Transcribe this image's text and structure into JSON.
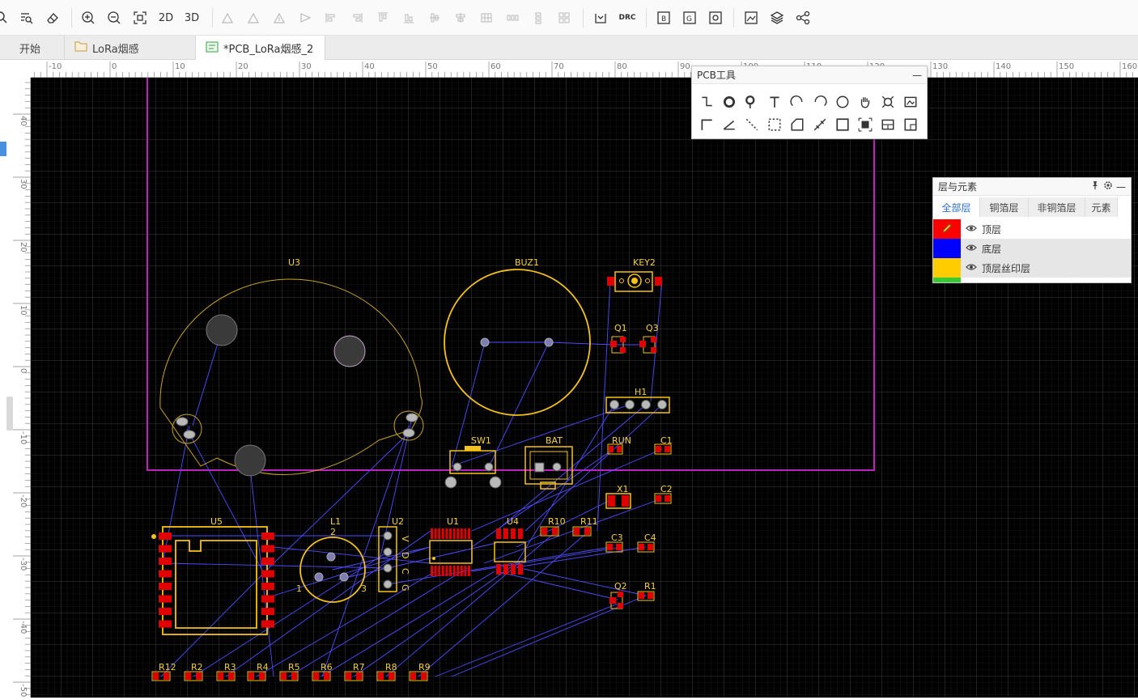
{
  "toolbar": {
    "view2d": "2D",
    "view3d": "3D",
    "drc": "DRC"
  },
  "tabs": [
    {
      "label": "开始"
    },
    {
      "label": "LoRa烟感"
    },
    {
      "label": "*PCB_LoRa烟感_2"
    }
  ],
  "ruler": {
    "top_ticks": [
      "-10",
      "0",
      "10",
      "20",
      "30",
      "40",
      "50",
      "60",
      "70",
      "80",
      "90",
      "100",
      "110",
      "120",
      "130",
      "140",
      "150",
      "160"
    ],
    "left_ticks": [
      "40",
      "30",
      "20",
      "10",
      "0",
      "-10",
      "-20",
      "-30",
      "-40",
      "-50"
    ]
  },
  "pcb_tools": {
    "title": "PCB工具",
    "minimize": "—"
  },
  "layers_panel": {
    "title": "层与元素",
    "tabs": [
      "全部层",
      "铜箔层",
      "非铜箔层",
      "元素"
    ],
    "layers": [
      {
        "name": "顶层",
        "color": "#ff0000"
      },
      {
        "name": "底层",
        "color": "#0000ff"
      },
      {
        "name": "顶层丝印层",
        "color": "#ffcc00"
      }
    ],
    "minimize": "—"
  },
  "components": {
    "U3": "U3",
    "BUZ1": "BUZ1",
    "KEY2": "KEY2",
    "Q1": "Q1",
    "Q3": "Q3",
    "H1": "H1",
    "SW1": "SW1",
    "BAT": "BAT",
    "RUN": "RUN",
    "C1": "C1",
    "X1": "X1",
    "C2": "C2",
    "U5": "U5",
    "L1": "L1",
    "U2": "U2",
    "U1": "U1",
    "U4": "U4",
    "R10": "R10",
    "R11": "R11",
    "C3": "C3",
    "C4": "C4",
    "Q2": "Q2",
    "R1": "R1",
    "R12": "R12",
    "R2": "R2",
    "R3": "R3",
    "R4": "R4",
    "R5": "R5",
    "R6": "R6",
    "R7": "R7",
    "R8": "R8",
    "R9": "R9",
    "L1_pin2": "2",
    "L1_pin1": "1",
    "L1_pin3": "3",
    "U2_pins": [
      "V",
      "D",
      "C",
      "G"
    ]
  }
}
